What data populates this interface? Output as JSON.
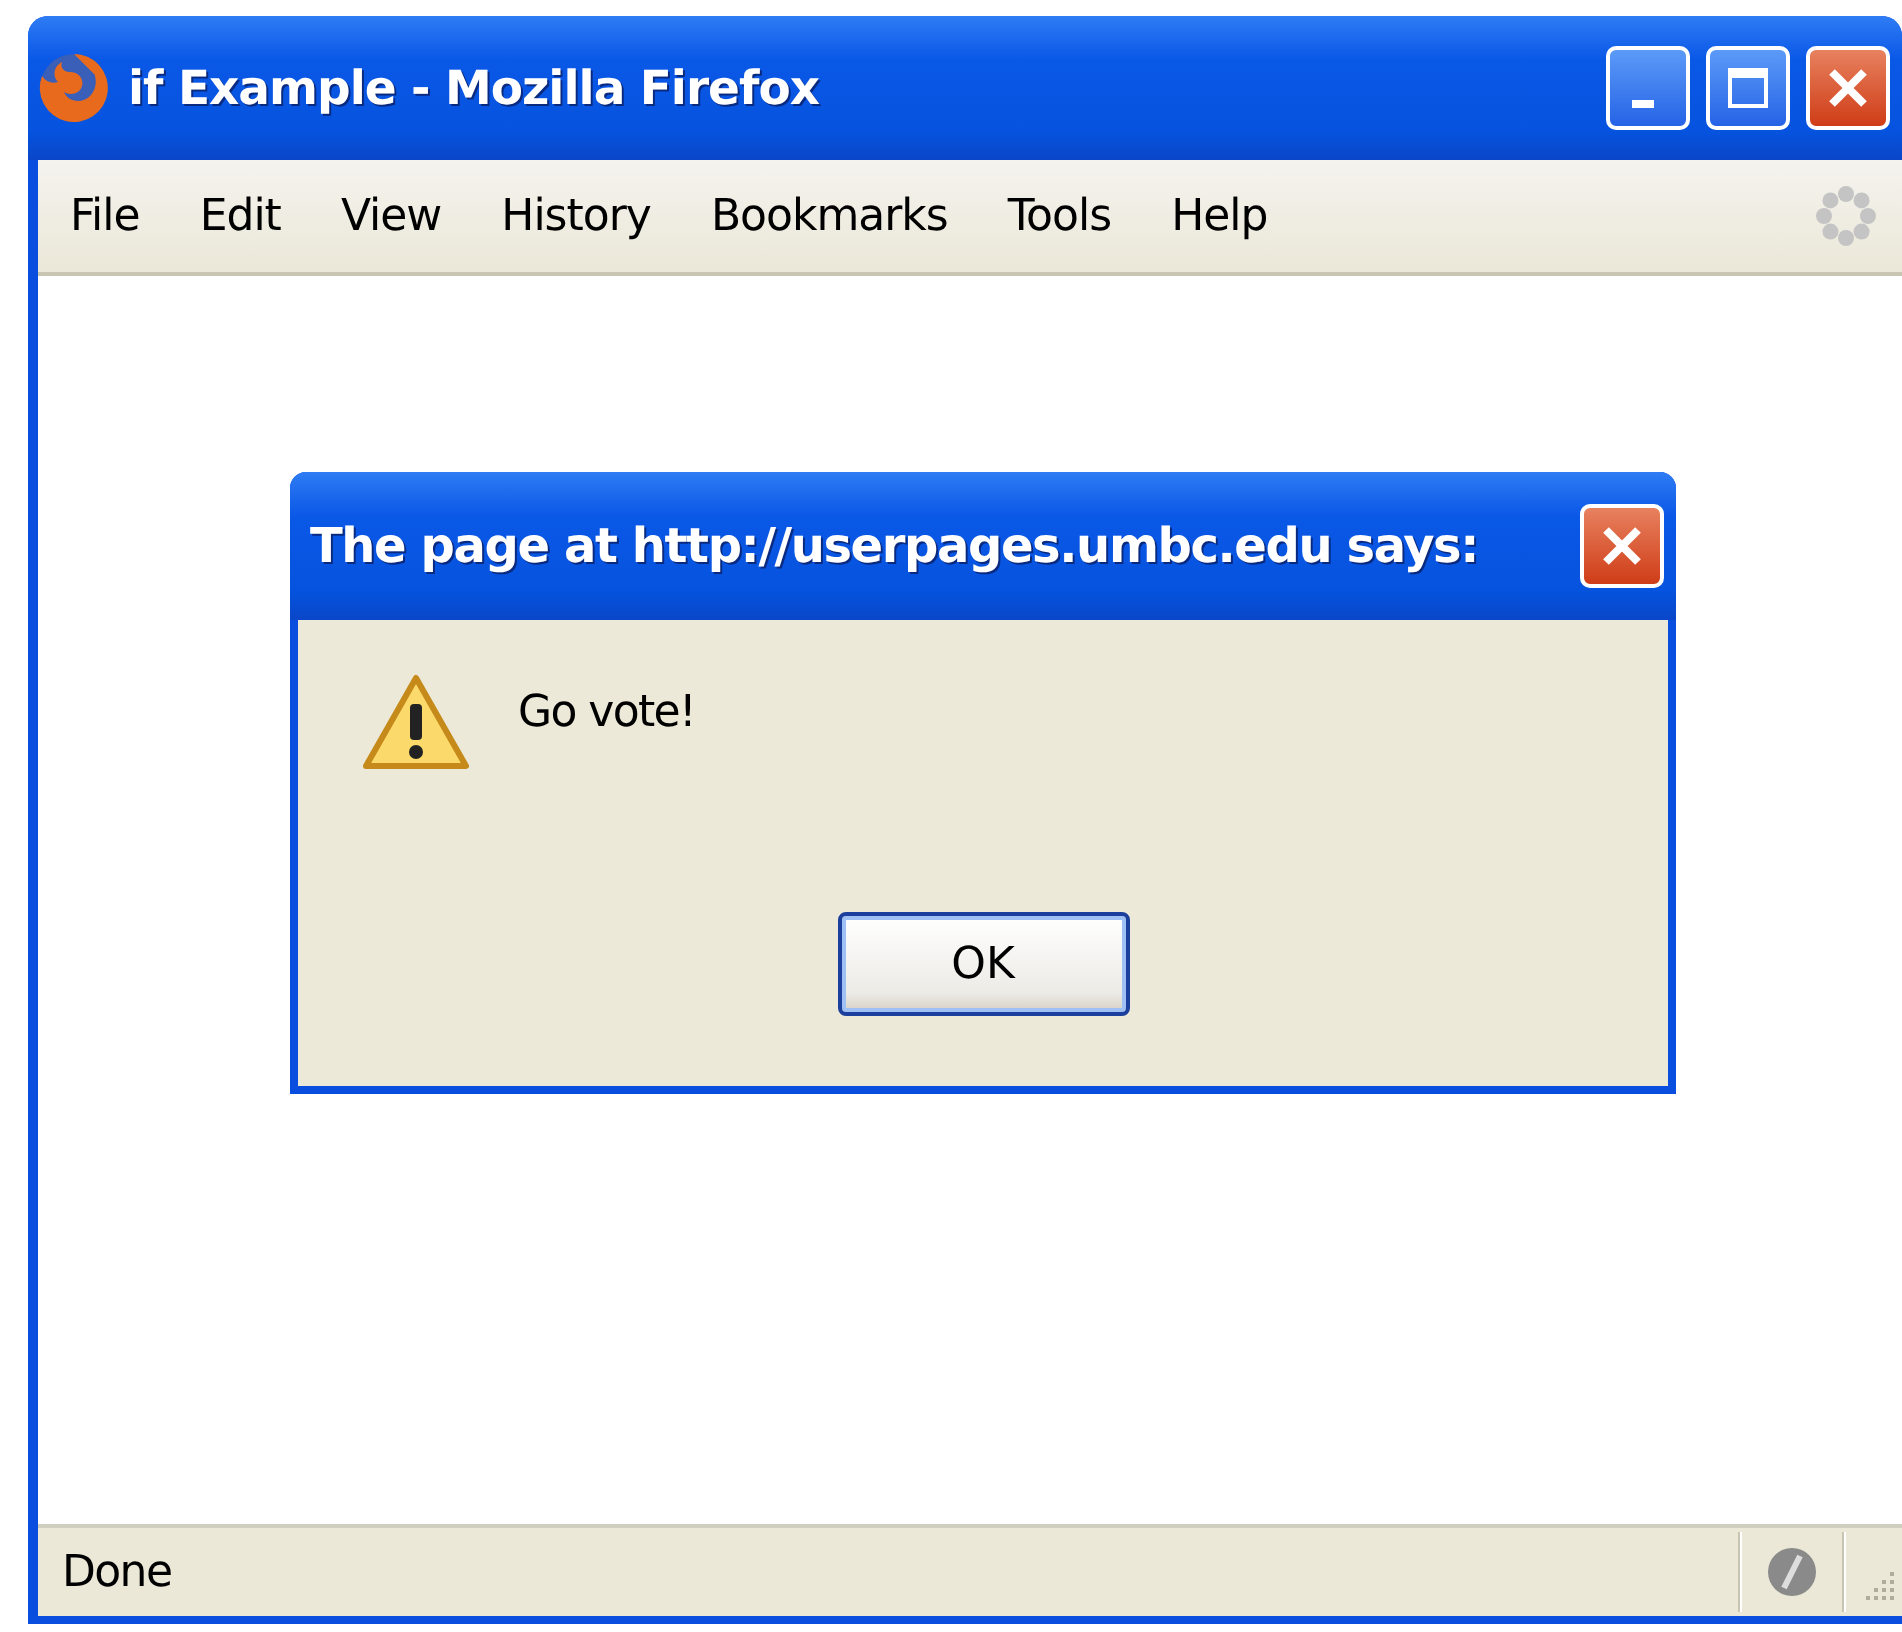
{
  "window": {
    "title": "if Example - Mozilla Firefox"
  },
  "menu": [
    "File",
    "Edit",
    "View",
    "History",
    "Bookmarks",
    "Tools",
    "Help"
  ],
  "dialog": {
    "title": "The page at http://userpages.umbc.edu says:",
    "message": "Go vote!",
    "buttons": [
      "OK"
    ]
  },
  "status_bar": {
    "text": "Done"
  }
}
